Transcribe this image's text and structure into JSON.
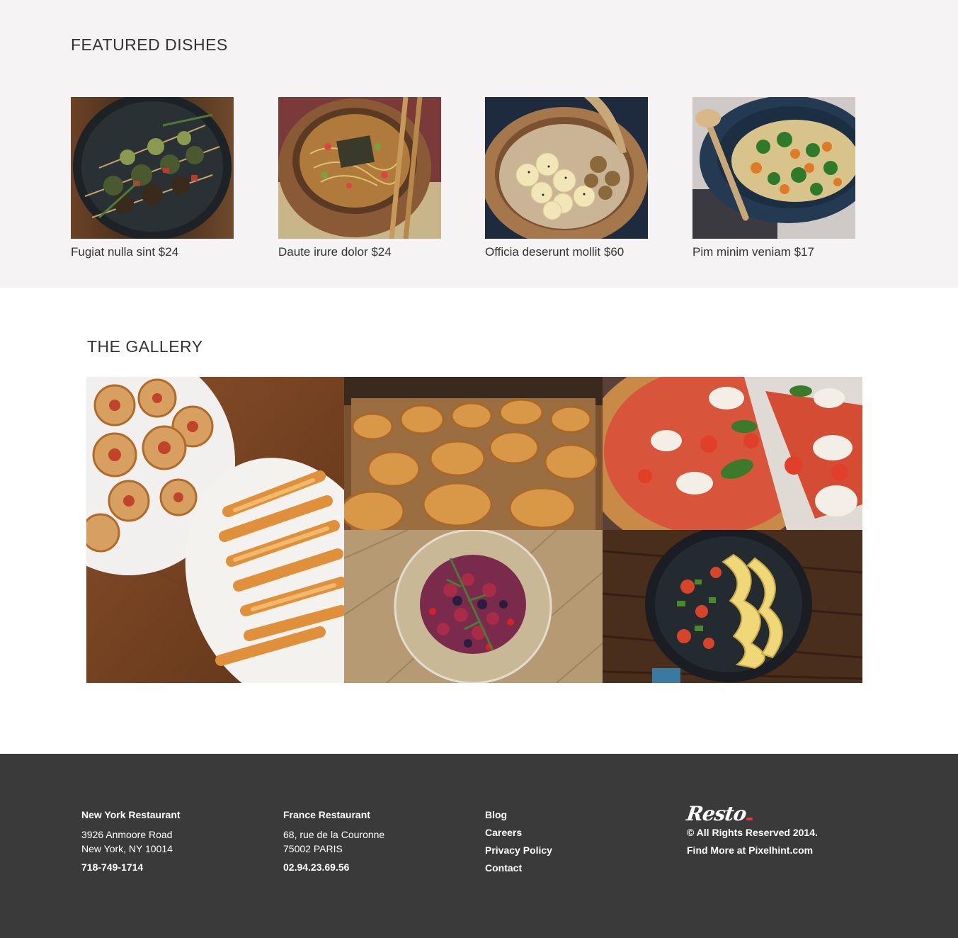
{
  "featured": {
    "title": "FEATURED DISHES",
    "dishes": [
      {
        "caption": "Fugiat nulla sint $24",
        "image": "grilled-skewers"
      },
      {
        "caption": "Daute irure dolor $24",
        "image": "noodle-bowl"
      },
      {
        "caption": "Officia deserunt mollit $60",
        "image": "banana-oat-bowl"
      },
      {
        "caption": "Pim minim veniam $17",
        "image": "vegetable-pan"
      }
    ]
  },
  "gallery": {
    "title": "THE GALLERY",
    "images": [
      "pastry-platter",
      "croissants-tray",
      "pizza-slices",
      "berry-bowl",
      "pasta-pan"
    ]
  },
  "footer": {
    "ny": {
      "title": "New York Restaurant",
      "address1": "3926 Anmoore Road",
      "address2": "New York, NY 10014",
      "phone": "718-749-1714"
    },
    "fr": {
      "title": "France Restaurant",
      "address1": "68, rue de la Couronne",
      "address2": "75002 PARIS",
      "phone": "02.94.23.69.56"
    },
    "links": [
      "Blog",
      "Careers",
      "Privacy Policy",
      "Contact"
    ],
    "brand": {
      "logo": "Resto",
      "copyright": "© All Rights Reserved 2014.",
      "more": "Find More at Pixelhint.com"
    }
  },
  "colors": {
    "featured_bg": "#f5f3f4",
    "footer_bg": "#3a3a3a",
    "logo_accent": "#e23b3b"
  }
}
